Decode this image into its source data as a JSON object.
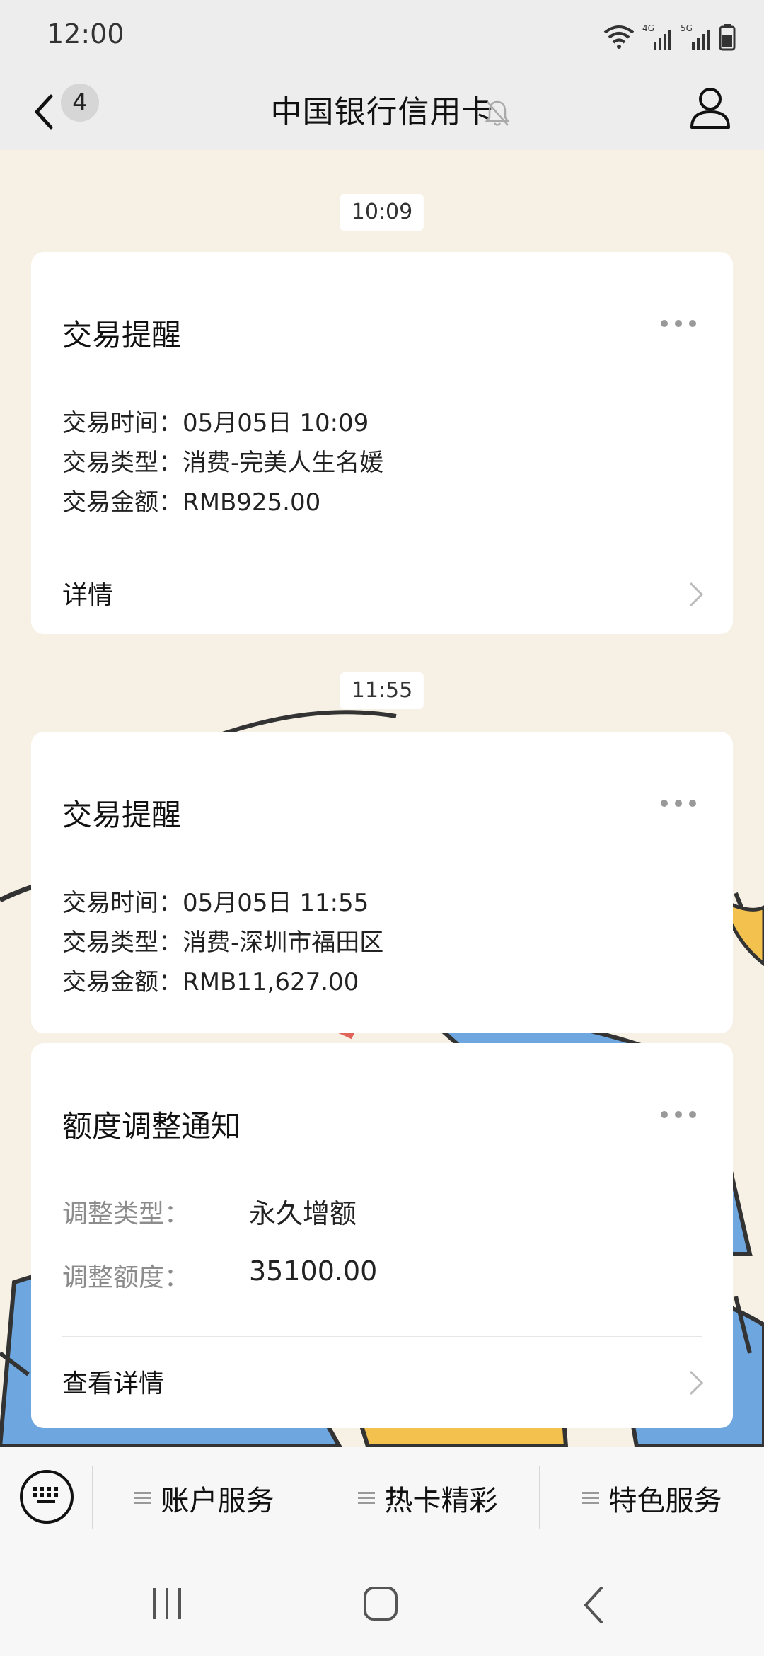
{
  "status_bar": {
    "time": "12:00",
    "network_4g": "4G",
    "network_5g": "5G"
  },
  "header": {
    "unread_count": "4",
    "title": "中国银行信用卡"
  },
  "messages": [
    {
      "timestamp": "10:09",
      "title": "交易提醒",
      "lines": [
        "交易时间：05月05日 10:09",
        "交易类型：消费-完美人生名媛",
        "交易金额：RMB925.00"
      ],
      "detail_label": "详情"
    },
    {
      "timestamp": "11:55",
      "title": "交易提醒",
      "lines": [
        "交易时间：05月05日 11:55",
        "交易类型：消费-深圳市福田区",
        "交易金额：RMB11,627.00"
      ]
    },
    {
      "title": "额度调整通知",
      "fields": [
        {
          "label": "调整类型：",
          "value": "永久增额"
        },
        {
          "label": "调整额度：",
          "value": "35100.00"
        }
      ],
      "detail_label": "查看详情"
    }
  ],
  "bottom_menu": {
    "items": [
      "账户服务",
      "热卡精彩",
      "特色服务"
    ]
  },
  "colors": {
    "chat_background": "#f6f1e4",
    "header_background": "#ededed",
    "card_background": "#ffffff"
  }
}
